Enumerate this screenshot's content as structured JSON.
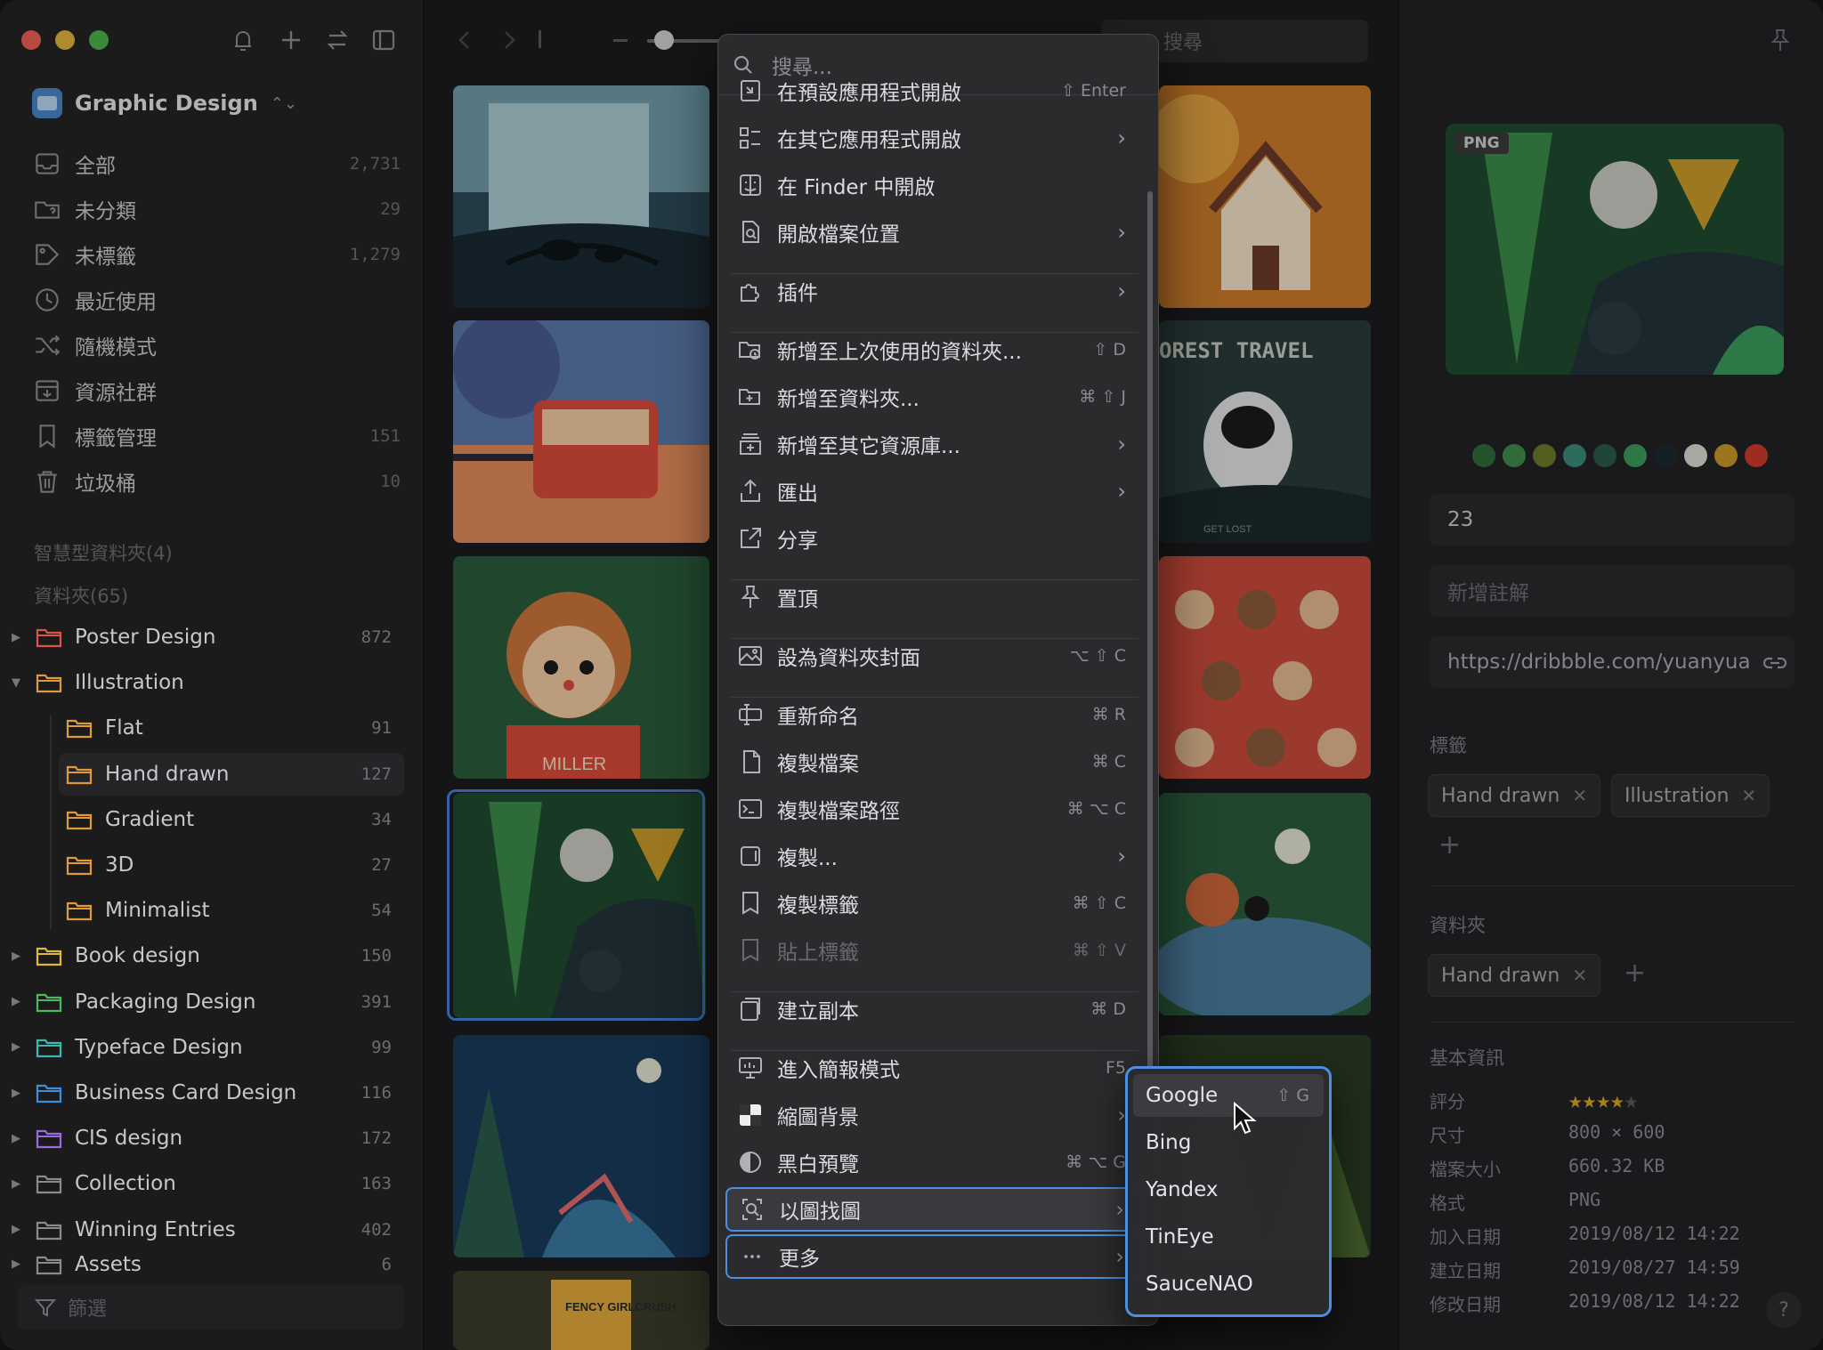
{
  "sidebar": {
    "library_name": "Graphic Design",
    "nav": [
      {
        "label": "全部",
        "count": "2,731",
        "icon": "inbox-icon"
      },
      {
        "label": "未分類",
        "count": "29",
        "icon": "folder-question-icon"
      },
      {
        "label": "未標籤",
        "count": "1,279",
        "icon": "tag-question-icon"
      },
      {
        "label": "最近使用",
        "count": "",
        "icon": "clock-icon"
      },
      {
        "label": "隨機模式",
        "count": "",
        "icon": "shuffle-icon"
      },
      {
        "label": "資源社群",
        "count": "",
        "icon": "community-icon"
      },
      {
        "label": "標籤管理",
        "count": "151",
        "icon": "bookmark-icon"
      },
      {
        "label": "垃圾桶",
        "count": "10",
        "icon": "trash-icon"
      }
    ],
    "smart_folders_header": "智慧型資料夾(4)",
    "folders_header": "資料夾(65)",
    "folders": [
      {
        "label": "Poster Design",
        "count": "872",
        "color": "#e0524a",
        "level": 0,
        "disclosure": "right"
      },
      {
        "label": "Illustration",
        "count": "",
        "color": "#e09a3a",
        "level": 0,
        "disclosure": "down"
      },
      {
        "label": "Flat",
        "count": "91",
        "color": "#e09a3a",
        "level": 1,
        "disclosure": ""
      },
      {
        "label": "Hand drawn",
        "count": "127",
        "color": "#e09a3a",
        "level": 1,
        "disclosure": "",
        "selected": true
      },
      {
        "label": "Gradient",
        "count": "34",
        "color": "#e09a3a",
        "level": 1,
        "disclosure": ""
      },
      {
        "label": "3D",
        "count": "27",
        "color": "#e09a3a",
        "level": 1,
        "disclosure": ""
      },
      {
        "label": "Minimalist",
        "count": "54",
        "color": "#e09a3a",
        "level": 1,
        "disclosure": ""
      },
      {
        "label": "Book design",
        "count": "150",
        "color": "#e0b83a",
        "level": 0,
        "disclosure": "right"
      },
      {
        "label": "Packaging Design",
        "count": "391",
        "color": "#4cb862",
        "level": 0,
        "disclosure": "right"
      },
      {
        "label": "Typeface Design",
        "count": "99",
        "color": "#3ab8b0",
        "level": 0,
        "disclosure": "right"
      },
      {
        "label": "Business Card Design",
        "count": "116",
        "color": "#3a8ee0",
        "level": 0,
        "disclosure": "right"
      },
      {
        "label": "CIS design",
        "count": "172",
        "color": "#9a6ae0",
        "level": 0,
        "disclosure": "right"
      },
      {
        "label": "Collection",
        "count": "163",
        "color": "#8a8a90",
        "level": 0,
        "disclosure": "right"
      },
      {
        "label": "Winning Entries",
        "count": "402",
        "color": "#8a8a90",
        "level": 0,
        "disclosure": "right"
      },
      {
        "label": "Assets",
        "count": "6",
        "color": "#8a8a90",
        "level": 0,
        "disclosure": "right"
      }
    ],
    "filter_label": "篩選"
  },
  "toolbar": {
    "search_placeholder": "搜尋"
  },
  "context_menu": {
    "search_placeholder": "搜尋...",
    "items": [
      {
        "label": "在預設應用程式開啟",
        "shortcut": "⇧ Enter",
        "arrow": false,
        "icon": "open-app-icon"
      },
      {
        "label": "在其它應用程式開啟",
        "shortcut": "",
        "arrow": true,
        "icon": "apps-grid-icon"
      },
      {
        "label": "在 Finder 中開啟",
        "shortcut": "",
        "arrow": false,
        "icon": "finder-icon"
      },
      {
        "label": "開啟檔案位置",
        "shortcut": "",
        "arrow": true,
        "icon": "file-search-icon"
      },
      {
        "label": "插件",
        "shortcut": "",
        "arrow": true,
        "icon": "puzzle-icon"
      },
      {
        "label": "新增至上次使用的資料夾...",
        "shortcut": "⇧ D",
        "arrow": false,
        "icon": "folder-recent-icon"
      },
      {
        "label": "新增至資料夾...",
        "shortcut": "⌘ ⇧ J",
        "arrow": false,
        "icon": "folder-add-icon"
      },
      {
        "label": "新增至其它資源庫...",
        "shortcut": "",
        "arrow": true,
        "icon": "library-add-icon"
      },
      {
        "label": "匯出",
        "shortcut": "",
        "arrow": true,
        "icon": "export-icon"
      },
      {
        "label": "分享",
        "shortcut": "",
        "arrow": false,
        "icon": "share-icon"
      },
      {
        "label": "置頂",
        "shortcut": "",
        "arrow": false,
        "icon": "pin-icon"
      },
      {
        "label": "設為資料夾封面",
        "shortcut": "⌥ ⇧ C",
        "arrow": false,
        "icon": "image-cover-icon"
      },
      {
        "label": "重新命名",
        "shortcut": "⌘ R",
        "arrow": false,
        "icon": "rename-icon"
      },
      {
        "label": "複製檔案",
        "shortcut": "⌘ C",
        "arrow": false,
        "icon": "copy-file-icon"
      },
      {
        "label": "複製檔案路徑",
        "shortcut": "⌘ ⌥ C",
        "arrow": false,
        "icon": "copy-path-icon"
      },
      {
        "label": "複製...",
        "shortcut": "",
        "arrow": true,
        "icon": "copy-icon"
      },
      {
        "label": "複製標籤",
        "shortcut": "⌘ ⇧ C",
        "arrow": false,
        "icon": "copy-tags-icon"
      },
      {
        "label": "貼上標籤",
        "shortcut": "⌘ ⇧ V",
        "arrow": false,
        "icon": "paste-tags-icon",
        "disabled": true
      },
      {
        "label": "建立副本",
        "shortcut": "⌘ D",
        "arrow": false,
        "icon": "duplicate-icon"
      },
      {
        "label": "進入簡報模式",
        "shortcut": "F5",
        "arrow": false,
        "icon": "presentation-icon"
      },
      {
        "label": "縮圖背景",
        "shortcut": "",
        "arrow": true,
        "icon": "checker-background-icon"
      },
      {
        "label": "黑白預覽",
        "shortcut": "⌘ ⌥ G",
        "arrow": false,
        "icon": "grayscale-icon"
      },
      {
        "label": "以圖找圖",
        "shortcut": "",
        "arrow": true,
        "icon": "image-search-icon",
        "active": true
      },
      {
        "label": "更多",
        "shortcut": "",
        "arrow": true,
        "icon": "more-icon"
      }
    ]
  },
  "submenu": {
    "items": [
      {
        "label": "Google",
        "shortcut": "⇧ G"
      },
      {
        "label": "Bing",
        "shortcut": ""
      },
      {
        "label": "Yandex",
        "shortcut": ""
      },
      {
        "label": "TinEye",
        "shortcut": ""
      },
      {
        "label": "SauceNAO",
        "shortcut": ""
      }
    ]
  },
  "inspector": {
    "preview_badge": "PNG",
    "palette": [
      "#2f6b3a",
      "#3f8a4a",
      "#6b7a2a",
      "#3a8a7a",
      "#2a5a4a",
      "#3a9a5a",
      "#1a2a30",
      "#d8d8d0",
      "#c8962a",
      "#c83a2a"
    ],
    "name_value": "23",
    "note_placeholder": "新增註解",
    "url_value": "https://dribbble.com/yuanyua",
    "tags_header": "標籤",
    "tags": [
      "Hand drawn",
      "Illustration"
    ],
    "folders_header": "資料夾",
    "folder_tags": [
      "Hand drawn"
    ],
    "basic_info_header": "基本資訊",
    "info": [
      {
        "key": "評分",
        "value": ""
      },
      {
        "key": "尺寸",
        "value": "800 × 600"
      },
      {
        "key": "檔案大小",
        "value": "660.32 KB"
      },
      {
        "key": "格式",
        "value": "PNG"
      },
      {
        "key": "加入日期",
        "value": "2019/08/12 14:22"
      },
      {
        "key": "建立日期",
        "value": "2019/08/27 14:59"
      },
      {
        "key": "修改日期",
        "value": "2019/08/12 14:22"
      }
    ],
    "rating": 4,
    "rating_max": 5,
    "help_label": "?"
  },
  "gallery": {
    "thumb_texts": [
      "OREST TRAVEL",
      "MILLER",
      "FENCY GIRLCRUSH",
      "GET LOST"
    ]
  }
}
